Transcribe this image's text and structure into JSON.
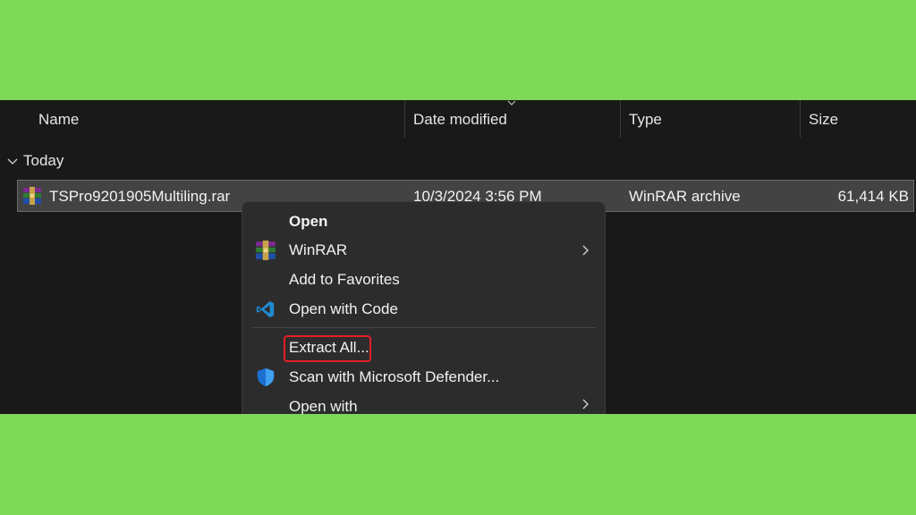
{
  "columns": {
    "name": "Name",
    "date_modified": "Date modified",
    "type": "Type",
    "size": "Size"
  },
  "group": {
    "label": "Today",
    "icon": "chevron-down-icon"
  },
  "file": {
    "name": "TSPro9201905Multiling.rar",
    "date_modified": "10/3/2024 3:56 PM",
    "type": "WinRAR archive",
    "size": "61,414 KB",
    "icon": "winrar-archive-icon"
  },
  "context_menu": {
    "items": [
      {
        "label": "Open",
        "icon": ""
      },
      {
        "label": "WinRAR",
        "icon": "winrar-icon",
        "submenu": true
      },
      {
        "label": "Add to Favorites",
        "icon": ""
      },
      {
        "label": "Open with Code",
        "icon": "vscode-icon"
      },
      {
        "label": "Extract All...",
        "icon": "",
        "highlighted": true
      },
      {
        "label": "Scan with Microsoft Defender...",
        "icon": "defender-shield-icon"
      },
      {
        "label": "Open with",
        "icon": "",
        "submenu": true
      }
    ]
  },
  "colors": {
    "background_green": "#7dd957",
    "explorer_bg": "#191919",
    "selected_row": "#434343",
    "menu_bg": "#2c2c2c",
    "highlight_red": "#e41e26"
  }
}
